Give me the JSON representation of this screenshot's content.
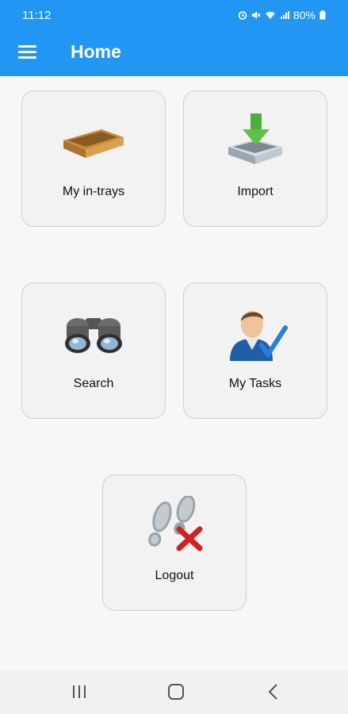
{
  "status": {
    "time": "11:12",
    "battery": "80%"
  },
  "app_bar": {
    "title": "Home"
  },
  "tiles": [
    {
      "label": "My in-trays",
      "icon": "in-tray-icon"
    },
    {
      "label": "Import",
      "icon": "import-icon"
    },
    {
      "label": "Search",
      "icon": "binoculars-icon"
    },
    {
      "label": "My Tasks",
      "icon": "user-check-icon"
    },
    {
      "label": "Logout",
      "icon": "footprints-x-icon"
    }
  ],
  "nav": {
    "icons": [
      "recent-apps-icon",
      "home-icon",
      "back-icon"
    ]
  },
  "colors": {
    "app_bar": "#2196f3",
    "background": "#f7f7f7",
    "tile_background": "#f2f2f2"
  }
}
